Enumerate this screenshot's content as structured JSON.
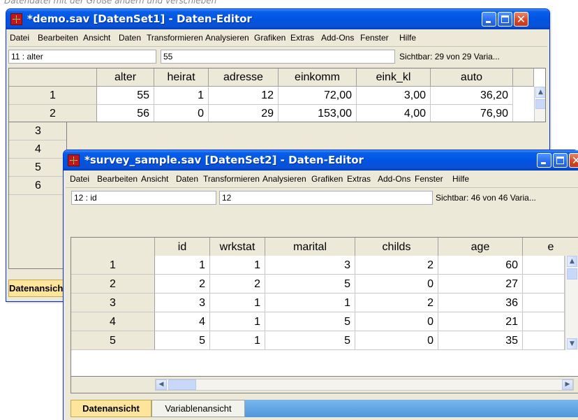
{
  "caption": "Datendatei mit der Größe ändern und verschieben",
  "win1": {
    "title": "*demo.sav [DatenSet1] - Daten-Editor",
    "menu": [
      "Datei",
      "Bearbeiten",
      "Ansicht",
      "Daten",
      "Transformieren",
      "Analysieren",
      "Grafiken",
      "Extras",
      "Add-Ons",
      "Fenster",
      "Hilfe"
    ],
    "cell_ref": "11 : alter",
    "cell_value": "55",
    "visible": "Sichtbar: 29 von 29 Varia...",
    "columns": [
      "alter",
      "heirat",
      "adresse",
      "einkomm",
      "eink_kl",
      "auto"
    ],
    "row_labels": [
      "1",
      "2",
      "3",
      "4",
      "5",
      "6"
    ],
    "row1": [
      "55",
      "1",
      "12",
      "72,00",
      "3,00",
      "36,20"
    ],
    "row2_partial": [
      "56",
      "0",
      "29",
      "153,00",
      "4,00",
      "76,90"
    ],
    "active_tab": "Datenansicht"
  },
  "win2": {
    "title": "*survey_sample.sav [DatenSet2] - Daten-Editor",
    "menu": [
      "Datei",
      "Bearbeiten",
      "Ansicht",
      "Daten",
      "Transformieren",
      "Analysieren",
      "Grafiken",
      "Extras",
      "Add-Ons",
      "Fenster",
      "Hilfe"
    ],
    "cell_ref": "12 : id",
    "cell_value": "12",
    "visible": "Sichtbar: 46 von 46 Varia...",
    "columns": [
      "id",
      "wrkstat",
      "marital",
      "childs",
      "age",
      "e"
    ],
    "rows": [
      {
        "label": "1",
        "values": [
          "1",
          "1",
          "3",
          "2",
          "60"
        ]
      },
      {
        "label": "2",
        "values": [
          "2",
          "2",
          "5",
          "0",
          "27"
        ]
      },
      {
        "label": "3",
        "values": [
          "3",
          "1",
          "1",
          "2",
          "36"
        ]
      },
      {
        "label": "4",
        "values": [
          "4",
          "1",
          "5",
          "0",
          "21"
        ]
      },
      {
        "label": "5",
        "values": [
          "5",
          "1",
          "5",
          "0",
          "35"
        ]
      }
    ],
    "tabs": {
      "data_view": "Datenansicht",
      "variable_view": "Variablenansicht"
    }
  }
}
